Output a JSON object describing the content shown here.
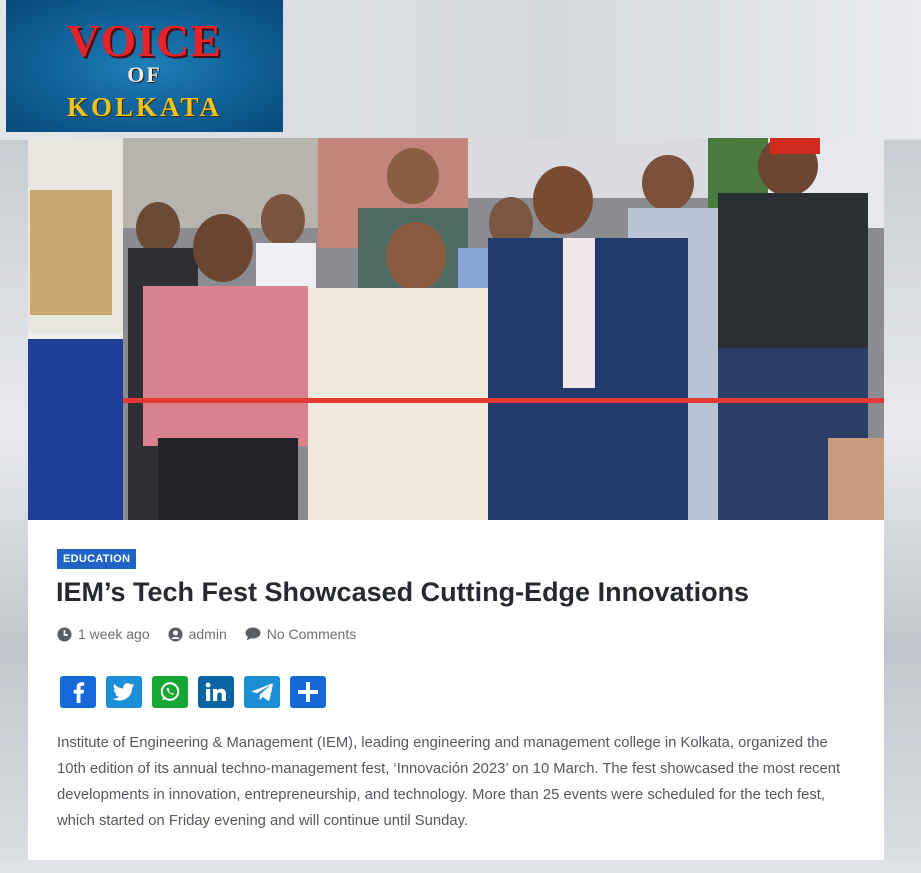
{
  "site": {
    "logo_line1": "VOICE",
    "logo_line2": "OF",
    "logo_line3": "KOLKATA"
  },
  "article": {
    "category": "EDUCATION",
    "title": "IEM’s Tech Fest Showcased Cutting-Edge Innovations",
    "meta": {
      "time": "1 week ago",
      "author": "admin",
      "comments": "No Comments"
    },
    "share_buttons": [
      {
        "name": "facebook-icon",
        "color": "#1668d8"
      },
      {
        "name": "twitter-icon",
        "color": "#1a8fd8"
      },
      {
        "name": "whatsapp-icon",
        "color": "#14a832"
      },
      {
        "name": "linkedin-icon",
        "color": "#0a66a2"
      },
      {
        "name": "telegram-icon",
        "color": "#1b8ed6"
      },
      {
        "name": "share-plus-icon",
        "color": "#1567d6"
      }
    ],
    "body": "Institute of Engineering & Management (IEM), leading engineering and management college in Kolkata, organized the 10th edition of its annual techno-management fest, ‘Innovación 2023’ on 10 March. The fest showcased the most recent developments in innovation, entrepreneurship, and technology. More than 25 events were scheduled for the tech fest, which started on Friday evening and will continue until Sunday."
  },
  "colors": {
    "badge": "#1f64c6",
    "title": "#262a30",
    "meta": "#6e7075",
    "body": "#55585e"
  }
}
